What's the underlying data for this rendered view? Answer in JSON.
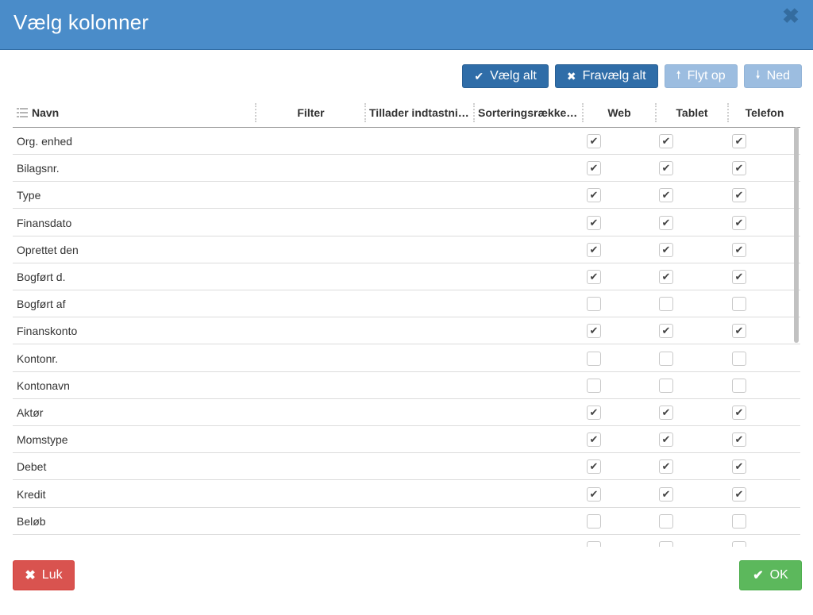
{
  "dialog": {
    "title": "Vælg kolonner",
    "close_icon": "✖"
  },
  "toolbar": {
    "select_all": {
      "icon": "✔",
      "label": "Vælg alt"
    },
    "deselect_all": {
      "icon": "✖",
      "label": "Fravælg alt"
    },
    "move_up": {
      "icon": "🠕",
      "label": "Flyt op"
    },
    "move_down": {
      "icon": "🠗",
      "label": "Ned"
    }
  },
  "table": {
    "headers": [
      "Navn",
      "Filter",
      "Tillader indtastning",
      "Sorteringsrækkefølge",
      "Web",
      "Tablet",
      "Telefon"
    ],
    "rows": [
      {
        "name": "Org. enhed",
        "web": true,
        "tablet": true,
        "phone": true
      },
      {
        "name": "Bilagsnr.",
        "web": true,
        "tablet": true,
        "phone": true
      },
      {
        "name": "Type",
        "web": true,
        "tablet": true,
        "phone": true
      },
      {
        "name": "Finansdato",
        "web": true,
        "tablet": true,
        "phone": true
      },
      {
        "name": "Oprettet den",
        "web": true,
        "tablet": true,
        "phone": true
      },
      {
        "name": "Bogført d.",
        "web": true,
        "tablet": true,
        "phone": true
      },
      {
        "name": "Bogført af",
        "web": false,
        "tablet": false,
        "phone": false
      },
      {
        "name": "Finanskonto",
        "web": true,
        "tablet": true,
        "phone": true
      },
      {
        "name": "Kontonr.",
        "web": false,
        "tablet": false,
        "phone": false
      },
      {
        "name": "Kontonavn",
        "web": false,
        "tablet": false,
        "phone": false
      },
      {
        "name": "Aktør",
        "web": true,
        "tablet": true,
        "phone": true
      },
      {
        "name": "Momstype",
        "web": true,
        "tablet": true,
        "phone": true
      },
      {
        "name": "Debet",
        "web": true,
        "tablet": true,
        "phone": true
      },
      {
        "name": "Kredit",
        "web": true,
        "tablet": true,
        "phone": true
      },
      {
        "name": "Beløb",
        "web": false,
        "tablet": false,
        "phone": false
      },
      {
        "name": "",
        "web": false,
        "tablet": false,
        "phone": false
      }
    ]
  },
  "footer": {
    "close": {
      "icon": "✖",
      "label": "Luk"
    },
    "ok": {
      "icon": "✔",
      "label": "OK"
    }
  },
  "colors": {
    "header": "#4a8cc9",
    "primary_button": "#2f6da8",
    "disabled_button": "#9cbde0",
    "danger": "#d9534f",
    "success": "#5cb85c"
  }
}
